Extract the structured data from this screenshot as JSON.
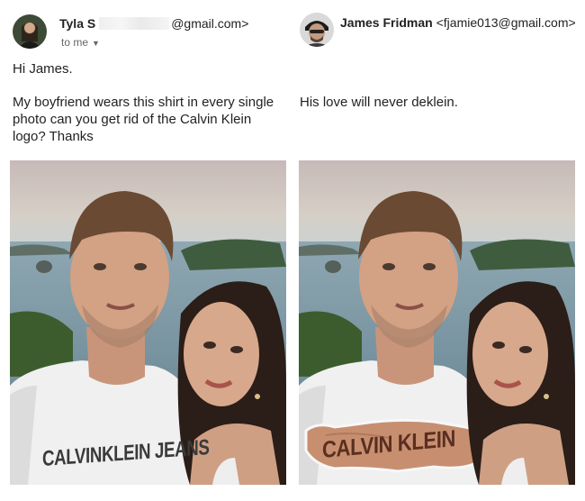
{
  "left": {
    "sender_name": "Tyla S",
    "sender_email": "@gmail.com>",
    "recipient": "to me",
    "greeting": "Hi James.",
    "message": "My boyfriend wears this shirt in every single photo can you get rid of the Calvin Klein logo? Thanks",
    "shirt_logo": "CALVINKLEIN JEANS"
  },
  "right": {
    "sender_name": "James Fridman",
    "sender_email": "<fjamie013@gmail.com>",
    "reply": "His love will never deklein.",
    "shirt_logo": "CALVIN KLEIN"
  }
}
